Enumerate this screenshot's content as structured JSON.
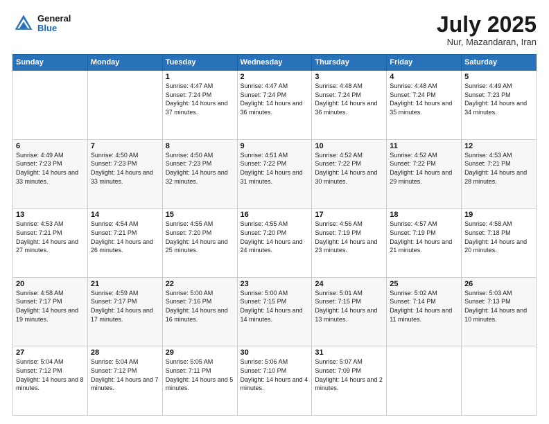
{
  "header": {
    "logo_general": "General",
    "logo_blue": "Blue",
    "month": "July 2025",
    "location": "Nur, Mazandaran, Iran"
  },
  "days_of_week": [
    "Sunday",
    "Monday",
    "Tuesday",
    "Wednesday",
    "Thursday",
    "Friday",
    "Saturday"
  ],
  "weeks": [
    [
      {
        "day": "",
        "info": ""
      },
      {
        "day": "",
        "info": ""
      },
      {
        "day": "1",
        "info": "Sunrise: 4:47 AM\nSunset: 7:24 PM\nDaylight: 14 hours and 37 minutes."
      },
      {
        "day": "2",
        "info": "Sunrise: 4:47 AM\nSunset: 7:24 PM\nDaylight: 14 hours and 36 minutes."
      },
      {
        "day": "3",
        "info": "Sunrise: 4:48 AM\nSunset: 7:24 PM\nDaylight: 14 hours and 36 minutes."
      },
      {
        "day": "4",
        "info": "Sunrise: 4:48 AM\nSunset: 7:24 PM\nDaylight: 14 hours and 35 minutes."
      },
      {
        "day": "5",
        "info": "Sunrise: 4:49 AM\nSunset: 7:23 PM\nDaylight: 14 hours and 34 minutes."
      }
    ],
    [
      {
        "day": "6",
        "info": "Sunrise: 4:49 AM\nSunset: 7:23 PM\nDaylight: 14 hours and 33 minutes."
      },
      {
        "day": "7",
        "info": "Sunrise: 4:50 AM\nSunset: 7:23 PM\nDaylight: 14 hours and 33 minutes."
      },
      {
        "day": "8",
        "info": "Sunrise: 4:50 AM\nSunset: 7:23 PM\nDaylight: 14 hours and 32 minutes."
      },
      {
        "day": "9",
        "info": "Sunrise: 4:51 AM\nSunset: 7:22 PM\nDaylight: 14 hours and 31 minutes."
      },
      {
        "day": "10",
        "info": "Sunrise: 4:52 AM\nSunset: 7:22 PM\nDaylight: 14 hours and 30 minutes."
      },
      {
        "day": "11",
        "info": "Sunrise: 4:52 AM\nSunset: 7:22 PM\nDaylight: 14 hours and 29 minutes."
      },
      {
        "day": "12",
        "info": "Sunrise: 4:53 AM\nSunset: 7:21 PM\nDaylight: 14 hours and 28 minutes."
      }
    ],
    [
      {
        "day": "13",
        "info": "Sunrise: 4:53 AM\nSunset: 7:21 PM\nDaylight: 14 hours and 27 minutes."
      },
      {
        "day": "14",
        "info": "Sunrise: 4:54 AM\nSunset: 7:21 PM\nDaylight: 14 hours and 26 minutes."
      },
      {
        "day": "15",
        "info": "Sunrise: 4:55 AM\nSunset: 7:20 PM\nDaylight: 14 hours and 25 minutes."
      },
      {
        "day": "16",
        "info": "Sunrise: 4:55 AM\nSunset: 7:20 PM\nDaylight: 14 hours and 24 minutes."
      },
      {
        "day": "17",
        "info": "Sunrise: 4:56 AM\nSunset: 7:19 PM\nDaylight: 14 hours and 23 minutes."
      },
      {
        "day": "18",
        "info": "Sunrise: 4:57 AM\nSunset: 7:19 PM\nDaylight: 14 hours and 21 minutes."
      },
      {
        "day": "19",
        "info": "Sunrise: 4:58 AM\nSunset: 7:18 PM\nDaylight: 14 hours and 20 minutes."
      }
    ],
    [
      {
        "day": "20",
        "info": "Sunrise: 4:58 AM\nSunset: 7:17 PM\nDaylight: 14 hours and 19 minutes."
      },
      {
        "day": "21",
        "info": "Sunrise: 4:59 AM\nSunset: 7:17 PM\nDaylight: 14 hours and 17 minutes."
      },
      {
        "day": "22",
        "info": "Sunrise: 5:00 AM\nSunset: 7:16 PM\nDaylight: 14 hours and 16 minutes."
      },
      {
        "day": "23",
        "info": "Sunrise: 5:00 AM\nSunset: 7:15 PM\nDaylight: 14 hours and 14 minutes."
      },
      {
        "day": "24",
        "info": "Sunrise: 5:01 AM\nSunset: 7:15 PM\nDaylight: 14 hours and 13 minutes."
      },
      {
        "day": "25",
        "info": "Sunrise: 5:02 AM\nSunset: 7:14 PM\nDaylight: 14 hours and 11 minutes."
      },
      {
        "day": "26",
        "info": "Sunrise: 5:03 AM\nSunset: 7:13 PM\nDaylight: 14 hours and 10 minutes."
      }
    ],
    [
      {
        "day": "27",
        "info": "Sunrise: 5:04 AM\nSunset: 7:12 PM\nDaylight: 14 hours and 8 minutes."
      },
      {
        "day": "28",
        "info": "Sunrise: 5:04 AM\nSunset: 7:12 PM\nDaylight: 14 hours and 7 minutes."
      },
      {
        "day": "29",
        "info": "Sunrise: 5:05 AM\nSunset: 7:11 PM\nDaylight: 14 hours and 5 minutes."
      },
      {
        "day": "30",
        "info": "Sunrise: 5:06 AM\nSunset: 7:10 PM\nDaylight: 14 hours and 4 minutes."
      },
      {
        "day": "31",
        "info": "Sunrise: 5:07 AM\nSunset: 7:09 PM\nDaylight: 14 hours and 2 minutes."
      },
      {
        "day": "",
        "info": ""
      },
      {
        "day": "",
        "info": ""
      }
    ]
  ]
}
